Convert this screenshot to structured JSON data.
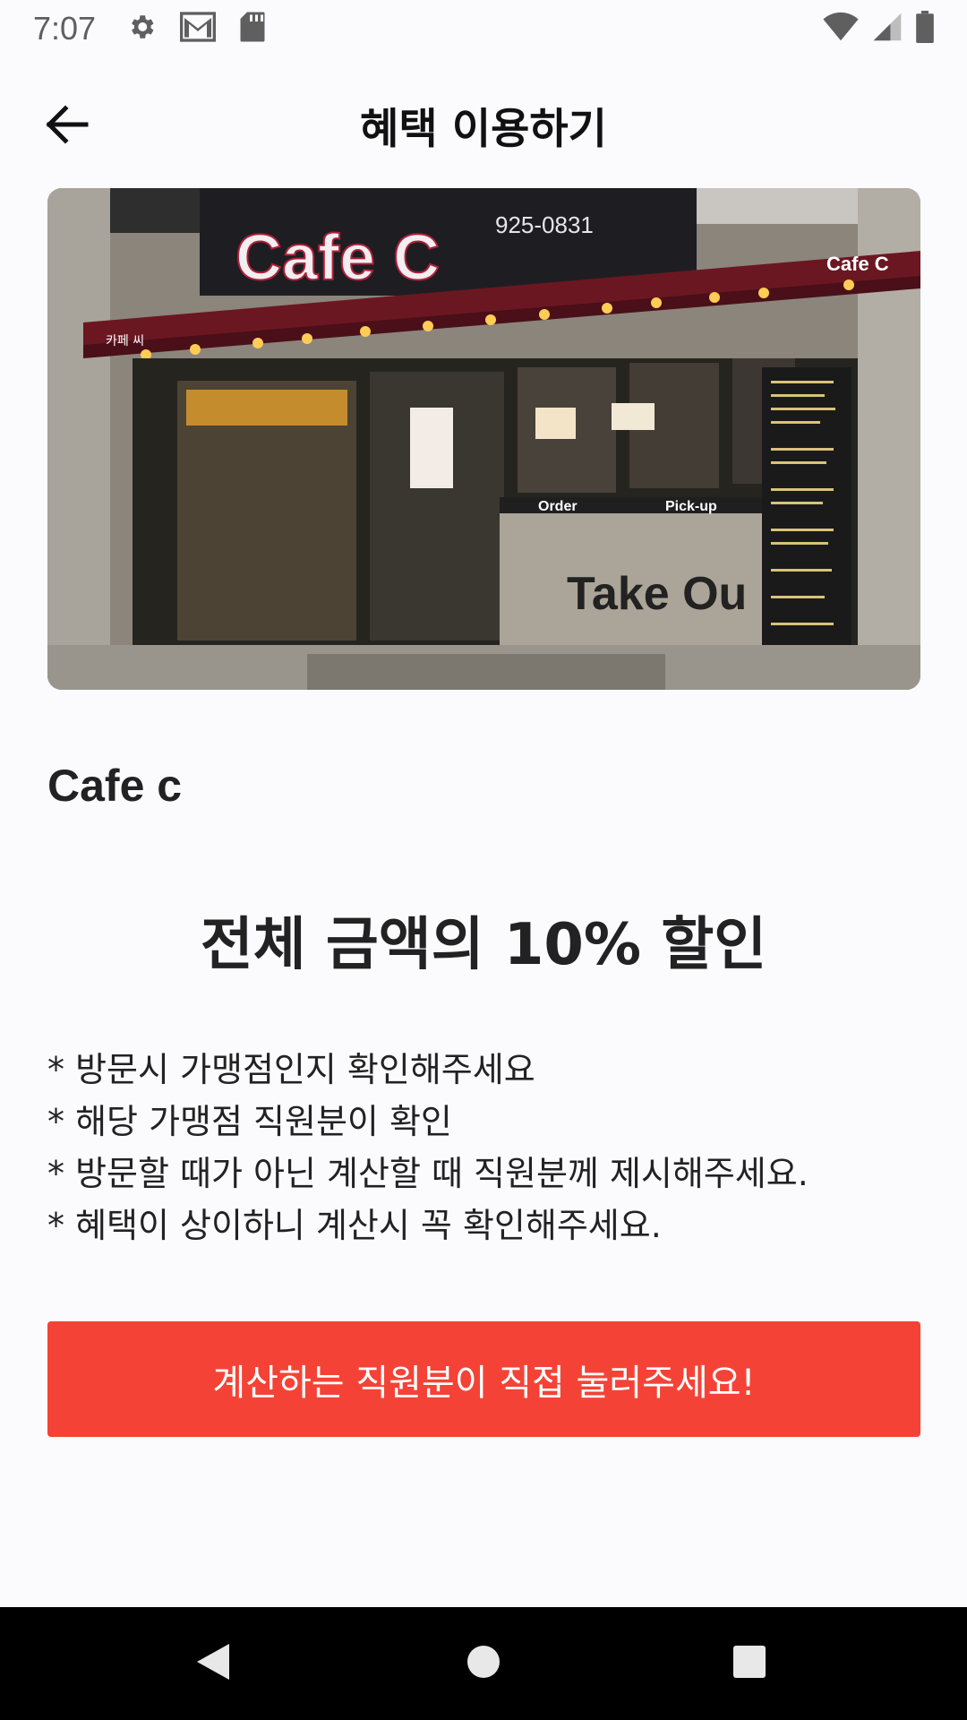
{
  "status_bar": {
    "time": "7:07",
    "icons": [
      "settings-icon",
      "gmail-icon",
      "sd-card-icon",
      "wifi-icon",
      "signal-icon",
      "battery-icon"
    ]
  },
  "app_bar": {
    "title": "혜택 이용하기",
    "back_icon": "arrow-left-icon"
  },
  "hero": {
    "sign_text": "Cafe C",
    "phone": "925-0831",
    "awning_text": "Cafe C",
    "korean_sign": "카페 씨",
    "order_label": "Order",
    "pickup_label": "Pick-up",
    "takeout_text": "Take Ou"
  },
  "store": {
    "name": "Cafe c"
  },
  "benefit": {
    "headline": "전체 금액의 10% 할인"
  },
  "notes": [
    "* 방문시 가맹점인지 확인해주세요",
    "* 해당 가맹점 직원분이 확인",
    "* 방문할 때가 아닌 계산할 때 직원분께 제시해주세요.",
    "* 혜택이 상이하니 계산시 꼭 확인해주세요."
  ],
  "cta": {
    "label": "계산하는 직원분이 직접 눌러주세요!",
    "color": "#f44336"
  },
  "nav_bar": {
    "icons": [
      "back-triangle-icon",
      "home-circle-icon",
      "recents-square-icon"
    ]
  }
}
